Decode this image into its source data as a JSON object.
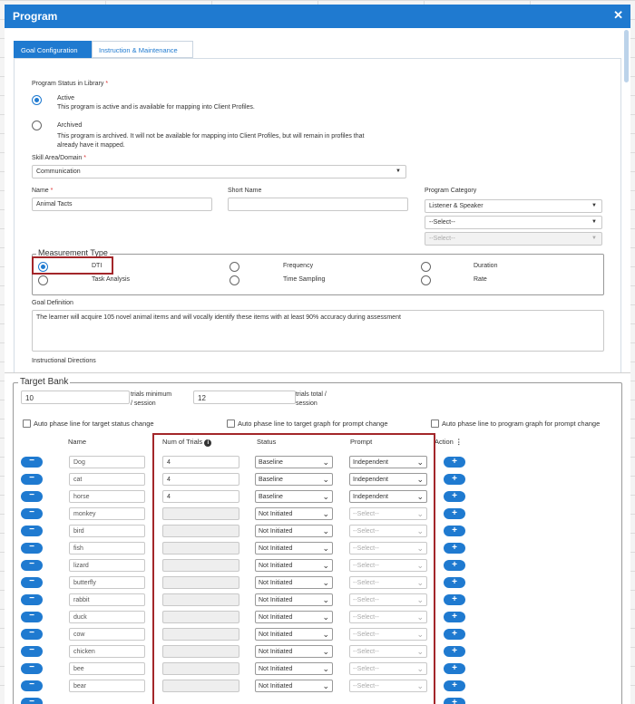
{
  "window": {
    "title": "Program",
    "close_icon": "close-icon"
  },
  "tabs": [
    {
      "label": "Goal Configuration"
    },
    {
      "label": "Instruction & Maintenance"
    }
  ],
  "program_status": {
    "label": "Program Status in Library",
    "required": "*",
    "options": [
      {
        "title": "Active",
        "desc": "This program is active and is available for mapping into Client Profiles.",
        "selected": true
      },
      {
        "title": "Archived",
        "desc1": "This program is archived. It will not be available for mapping into Client Profiles, but will remain in profiles that",
        "desc2": "already have it mapped.",
        "selected": false
      }
    ]
  },
  "skill_area": {
    "label": "Skill Area/Domain",
    "required": "*",
    "value": "Communication"
  },
  "name": {
    "label": "Name",
    "required": "*",
    "value": "Animal Tacts"
  },
  "short_name": {
    "label": "Short Name",
    "value": ""
  },
  "program_category": {
    "label": "Program Category",
    "value": "Listener & Speaker",
    "select2": "--Select--",
    "select3": "--Select--"
  },
  "measurement_type": {
    "legend": "Measurement Type",
    "options": [
      "DTI",
      "Frequency",
      "Duration",
      "Task Analysis",
      "Time Sampling",
      "Rate"
    ],
    "selected": "DTI"
  },
  "goal_definition": {
    "label": "Goal Definition",
    "value": "The learner will acquire 105 novel animal items and will vocally identify these items with at least 90% accuracy during assessment"
  },
  "instructional_directions": {
    "label": "Instructional Directions"
  },
  "target_bank": {
    "legend": "Target Bank",
    "trials_min": "10",
    "trials_min_label1": "trials minimum",
    "trials_min_label2": "/ session",
    "trials_total": "12",
    "trials_total_label1": "trials total /",
    "trials_total_label2": "session",
    "checkboxes": [
      "Auto phase line for target status change",
      "Auto phase line to target graph for prompt change",
      "Auto phase line to program graph for prompt change"
    ],
    "headers": {
      "name": "Name",
      "trials": "Num of Trials",
      "status": "Status",
      "prompt": "Prompt",
      "action": "Action"
    },
    "rows": [
      {
        "name": "Dog",
        "trials": "4",
        "status": "Baseline",
        "prompt": "Independent"
      },
      {
        "name": "cat",
        "trials": "4",
        "status": "Baseline",
        "prompt": "Independent"
      },
      {
        "name": "horse",
        "trials": "4",
        "status": "Baseline",
        "prompt": "Independent"
      },
      {
        "name": "monkey",
        "trials": "",
        "status": "Not Initiated",
        "prompt": "--Select--"
      },
      {
        "name": "bird",
        "trials": "",
        "status": "Not Initiated",
        "prompt": "--Select--"
      },
      {
        "name": "fish",
        "trials": "",
        "status": "Not Initiated",
        "prompt": "--Select--"
      },
      {
        "name": "lizard",
        "trials": "",
        "status": "Not Initiated",
        "prompt": "--Select--"
      },
      {
        "name": "butterfly",
        "trials": "",
        "status": "Not Initiated",
        "prompt": "--Select--"
      },
      {
        "name": "rabbit",
        "trials": "",
        "status": "Not Initiated",
        "prompt": "--Select--"
      },
      {
        "name": "duck",
        "trials": "",
        "status": "Not Initiated",
        "prompt": "--Select--"
      },
      {
        "name": "cow",
        "trials": "",
        "status": "Not Initiated",
        "prompt": "--Select--"
      },
      {
        "name": "chicken",
        "trials": "",
        "status": "Not Initiated",
        "prompt": "--Select--"
      },
      {
        "name": "bee",
        "trials": "",
        "status": "Not Initiated",
        "prompt": "--Select--"
      },
      {
        "name": "bear",
        "trials": "",
        "status": "Not Initiated",
        "prompt": "--Select--"
      }
    ]
  },
  "colors": {
    "accent": "#1f7ad0",
    "highlight": "#a3262a"
  }
}
